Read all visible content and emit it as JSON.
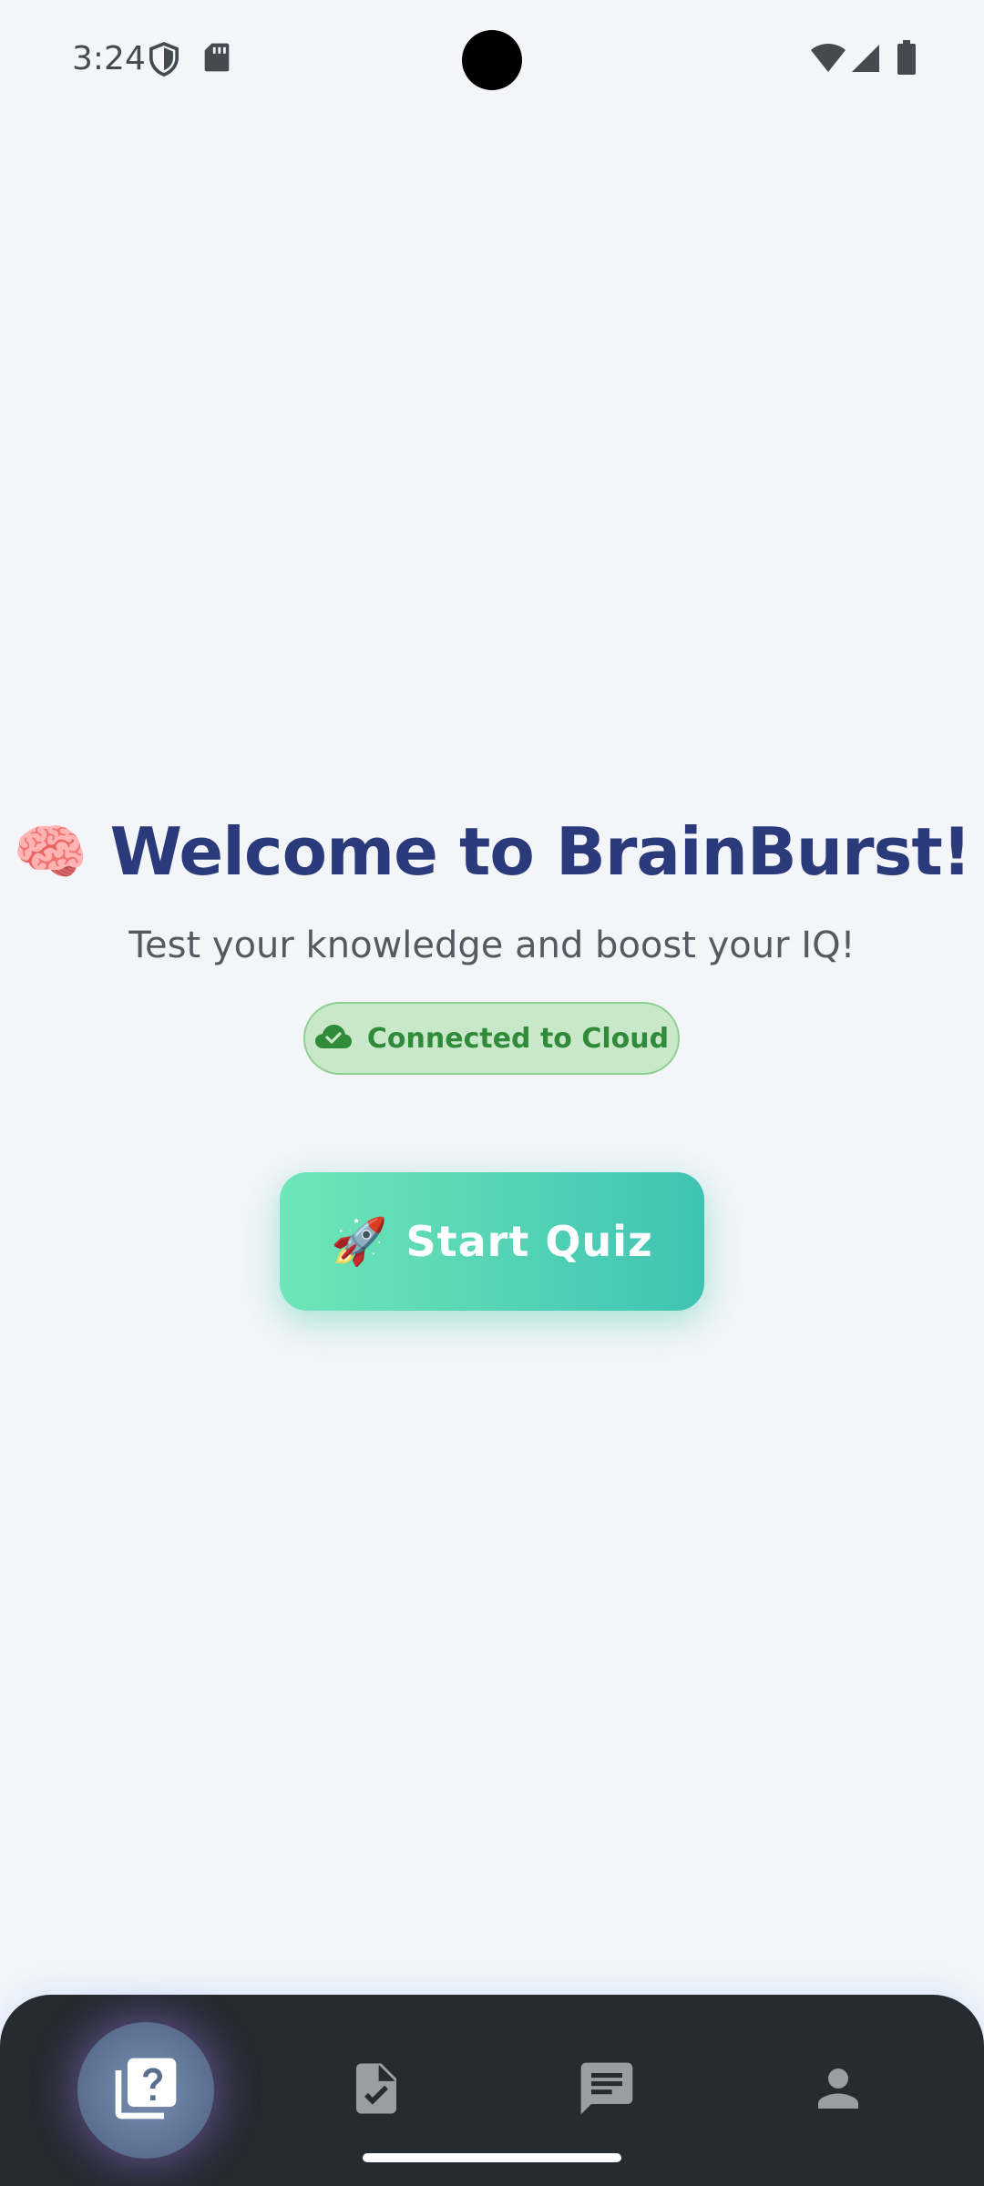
{
  "status_bar": {
    "time": "3:24",
    "left_icons": [
      "shield-icon",
      "sd-card-icon"
    ],
    "right_icons": [
      "wifi-icon",
      "cellular-icon",
      "battery-icon"
    ]
  },
  "welcome": {
    "emoji": "🧠",
    "title": "Welcome to BrainBurst!",
    "subtitle": "Test your knowledge and boost your IQ!"
  },
  "cloud_status": {
    "icon": "cloud-check-icon",
    "label": "Connected to Cloud",
    "color": "#2f8a3a"
  },
  "start_button": {
    "emoji": "🚀",
    "label": "Start Quiz",
    "gradient": [
      "#6ee6b8",
      "#3fc3b2"
    ]
  },
  "bottom_nav": {
    "items": [
      {
        "icon": "quiz-icon",
        "active": true
      },
      {
        "icon": "document-check-icon",
        "active": false
      },
      {
        "icon": "chat-icon",
        "active": false
      },
      {
        "icon": "profile-icon",
        "active": false
      }
    ]
  },
  "colors": {
    "background": "#f3f5f9",
    "title": "#2b3a7a",
    "nav_background": "#262b31"
  }
}
